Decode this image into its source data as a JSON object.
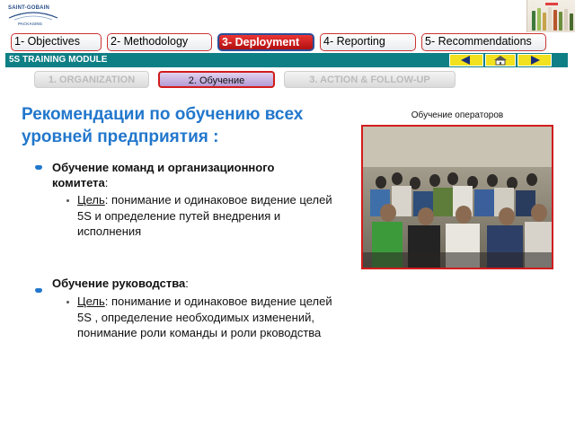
{
  "logo": {
    "brand": "SAINT-GOBAIN",
    "sub": "PACKAGING"
  },
  "nav": {
    "tabs": [
      {
        "label": "1- Objectives",
        "active": false
      },
      {
        "label": "2- Methodology",
        "active": false
      },
      {
        "label": "3- Deployment",
        "active": true
      },
      {
        "label": "4- Reporting",
        "active": false
      },
      {
        "label": "5- Recommendations",
        "active": false
      }
    ]
  },
  "module": {
    "title": "5S TRAINING MODULE",
    "controls": [
      "prev-arrow-icon",
      "home-icon",
      "next-arrow-icon"
    ],
    "control_color": "#f2e11e"
  },
  "subtabs": [
    {
      "label": "1. ORGANIZATION",
      "active": false
    },
    {
      "label": "2. Обучение",
      "active": true
    },
    {
      "label": "3. ACTION & FOLLOW-UP",
      "active": false
    }
  ],
  "content": {
    "heading": "Рекомендации по обучению всех уровней предприятия :",
    "sections": [
      {
        "title": "Обучение команд и организационного комитета",
        "colon": ":",
        "goal_label": "Цель",
        "goal_text": ": понимание и одинаковое видение целей 5S и определение путей внедрения и исполнения"
      },
      {
        "title": "Обучение руководства",
        "colon": ":",
        "goal_label": "Цель",
        "goal_text": ": понимание и одинаковое видение целей 5S , определение необходимых изменений, понимание роли команды и роли рководства"
      }
    ]
  },
  "photo": {
    "caption": "Обучение операторов"
  },
  "colors": {
    "accent": "#2277cc",
    "active_tab": "#d21c1c",
    "module_bar": "#0f7f86",
    "tab_border": "#cc3333"
  }
}
